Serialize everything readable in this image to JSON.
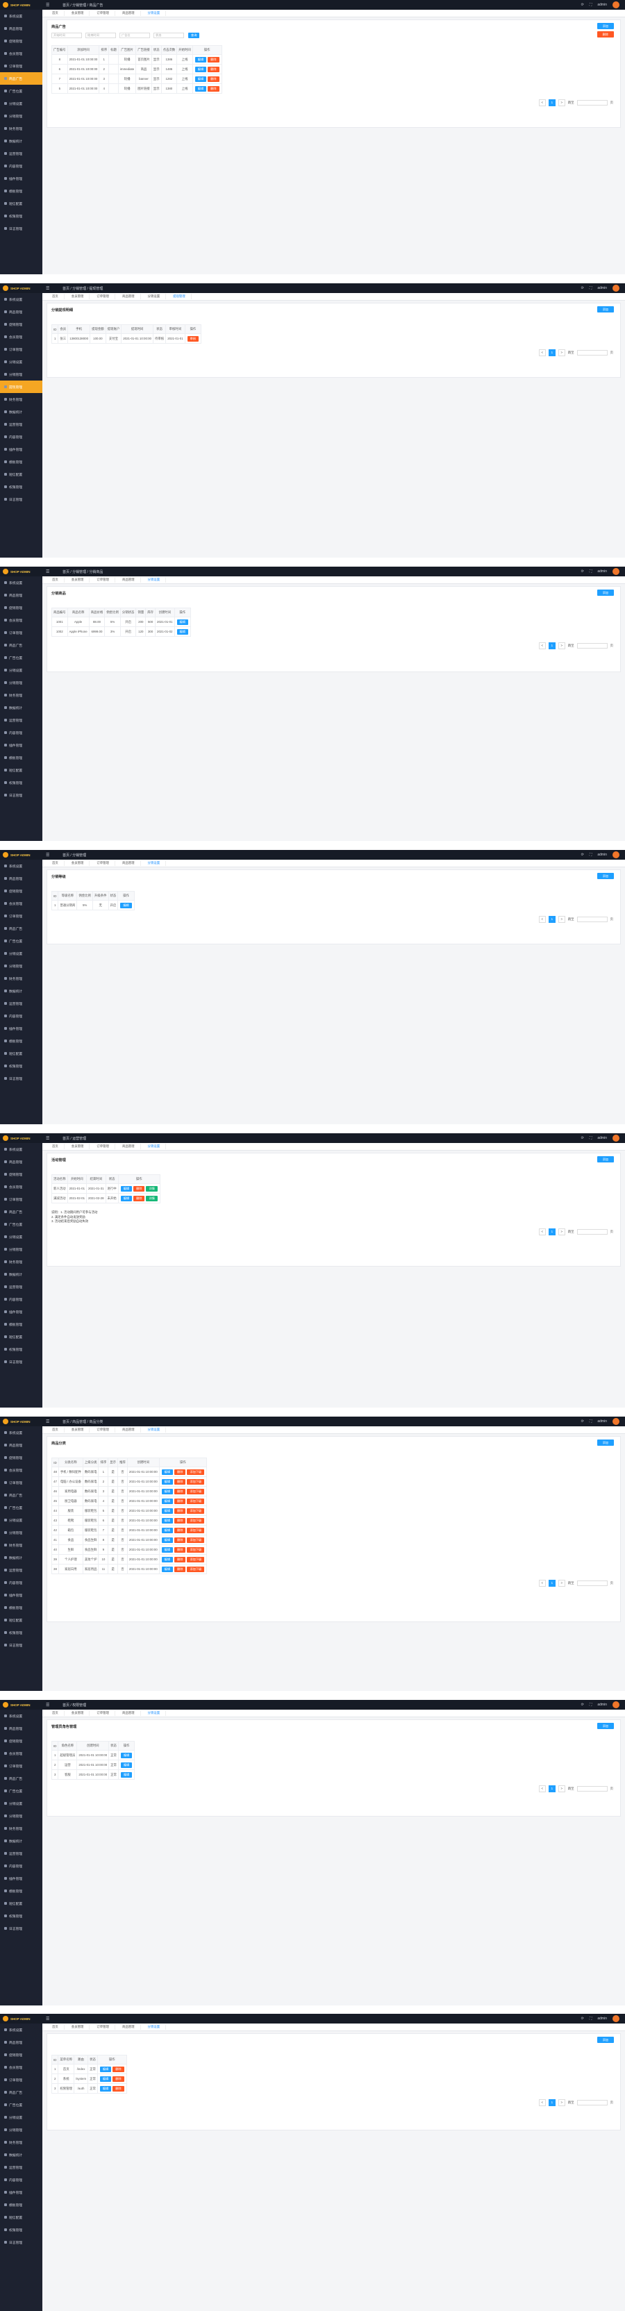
{
  "app": {
    "logo_text": "SHOP ADMIN",
    "watermark": "https://www.huzhan.com/ishop42377",
    "user": "admin"
  },
  "panels": [
    {
      "breadcrumb": "首页 / 分销管理 / 商品广告",
      "sidebar": [
        "系统设置",
        "商品管理",
        "促销管理",
        "会员管理",
        "订单管理",
        "商品广告",
        "广告位置",
        "分销设置",
        "分销管理",
        "财务管理",
        "数据统计",
        "运营管理",
        "内容管理",
        "插件管理",
        "模板管理",
        "短信配置",
        "权限管理",
        "日志管理"
      ],
      "active_sidebar": 5,
      "title": "商品广告",
      "tools": [
        "添加",
        "删除"
      ],
      "filters": [
        "开始时间",
        "结束时间",
        "广告位",
        "状态",
        "查询"
      ],
      "columns": [
        "广告编号",
        "添加时间",
        "排序",
        "标题",
        "广告图片",
        "广告链接",
        "状态",
        "点击次数",
        "开始时间",
        "操作"
      ],
      "rows": [
        [
          "8",
          "2021-01-01 10:00:00",
          "1",
          "",
          "轮播",
          "首页图片",
          "显示",
          "1386",
          "上线",
          ""
        ],
        [
          "6",
          "2021-01-01 10:00:00",
          "2",
          "",
          "immediate",
          "商品",
          "显示",
          "1486",
          "上线",
          ""
        ],
        [
          "7",
          "2021-01-01 10:00:00",
          "3",
          "",
          "轮播",
          "banner",
          "显示",
          "1282",
          "上线",
          ""
        ],
        [
          "5",
          "2021-01-01 10:00:00",
          "4",
          "",
          "轮播",
          "图片链接",
          "显示",
          "1380",
          "上线",
          ""
        ]
      ],
      "row_actions": [
        "编辑",
        "删除"
      ],
      "pager": [
        "1",
        "跳至",
        "页"
      ]
    },
    {
      "breadcrumb": "首页 / 分销管理 / 提现管理",
      "sidebar": [
        "系统设置",
        "商品管理",
        "促销管理",
        "会员管理",
        "订单管理",
        "分销设置",
        "分销管理",
        "提现管理",
        "财务管理",
        "数据统计",
        "运营管理",
        "内容管理",
        "插件管理",
        "模板管理",
        "短信配置",
        "权限管理",
        "日志管理"
      ],
      "active_sidebar": 7,
      "tabs": [
        "首页",
        "会员管理",
        "订单管理",
        "商品管理",
        "分销设置",
        "提现管理"
      ],
      "title": "分销提现明细",
      "columns": [
        "ID",
        "会员",
        "手机",
        "提现金额",
        "提现账户",
        "提现时间",
        "状态",
        "审核时间",
        "操作"
      ],
      "rows": [
        [
          "1",
          "张三",
          "13800138000",
          "100.00",
          "支付宝",
          "2021-01-01 10:00:00",
          "待审核",
          "2021-01-01",
          ""
        ]
      ],
      "row_actions": [
        "审核"
      ]
    },
    {
      "breadcrumb": "首页 / 分销管理 / 分销商品",
      "title": "分销商品",
      "columns": [
        "商品编号",
        "商品名称",
        "商品价格",
        "佣金比例",
        "分销状态",
        "销量",
        "库存",
        "创建时间",
        "操作"
      ],
      "rows": [
        [
          "1001",
          "Apple",
          "88.00",
          "5%",
          "开启",
          "200",
          "500",
          "2021-01-01",
          ""
        ],
        [
          "1002",
          "Apple iPhone",
          "6999.00",
          "3%",
          "开启",
          "120",
          "300",
          "2021-01-02",
          ""
        ]
      ],
      "row_actions": [
        "编辑"
      ]
    },
    {
      "breadcrumb": "首页 / 分销管理",
      "title": "分销等级",
      "columns": [
        "ID",
        "等级名称",
        "佣金比例",
        "升级条件",
        "状态",
        "操作"
      ],
      "rows": [
        [
          "1",
          "普通分销商",
          "5%",
          "无",
          "开启",
          ""
        ]
      ],
      "row_actions": [
        "编辑"
      ]
    },
    {
      "breadcrumb": "首页 / 运营管理",
      "title": "活动管理",
      "columns": [
        "活动名称",
        "开始时间",
        "结束时间",
        "状态",
        "操作"
      ],
      "rows": [
        [
          "新人活动",
          "2021-01-01",
          "2021-01-31",
          "进行中",
          ""
        ],
        [
          "满减活动",
          "2021-02-01",
          "2021-02-28",
          "未开始",
          ""
        ]
      ],
      "row_actions": [
        "编辑",
        "删除",
        "详情"
      ],
      "notes": "说明：1. 活动期间用户可参与活动\n2. 满足条件自动发放奖励\n3. 活动结束后奖励自动失效"
    },
    {
      "breadcrumb": "首页 / 商品管理 / 商品分类",
      "title": "商品分类",
      "columns": [
        "ID",
        "分类名称",
        "上级分类",
        "排序",
        "显示",
        "推荐",
        "创建时间",
        "操作"
      ],
      "rows": [
        [
          "48",
          "手机 / 数码配件",
          "数码家电",
          "1",
          "是",
          "否",
          "2021-01-01 10:00:00",
          ""
        ],
        [
          "47",
          "电脑 / 办公设备",
          "数码家电",
          "2",
          "是",
          "否",
          "2021-01-01 10:00:00",
          ""
        ],
        [
          "46",
          "家用电器",
          "数码家电",
          "3",
          "是",
          "否",
          "2021-01-01 10:00:00",
          ""
        ],
        [
          "45",
          "厨卫电器",
          "数码家电",
          "4",
          "是",
          "否",
          "2021-01-01 10:00:00",
          ""
        ],
        [
          "44",
          "服装",
          "服装鞋包",
          "5",
          "是",
          "否",
          "2021-01-01 10:00:00",
          ""
        ],
        [
          "43",
          "鞋靴",
          "服装鞋包",
          "6",
          "是",
          "否",
          "2021-01-01 10:00:00",
          ""
        ],
        [
          "42",
          "箱包",
          "服装鞋包",
          "7",
          "是",
          "否",
          "2021-01-01 10:00:00",
          ""
        ],
        [
          "41",
          "食品",
          "食品生鲜",
          "8",
          "是",
          "否",
          "2021-01-01 10:00:00",
          ""
        ],
        [
          "40",
          "生鲜",
          "食品生鲜",
          "9",
          "是",
          "否",
          "2021-01-01 10:00:00",
          ""
        ],
        [
          "39",
          "个人护理",
          "美妆个护",
          "10",
          "是",
          "否",
          "2021-01-01 10:00:00",
          ""
        ],
        [
          "38",
          "家居日用",
          "家居用品",
          "11",
          "是",
          "否",
          "2021-01-01 10:00:00",
          ""
        ]
      ],
      "row_actions": [
        "编辑",
        "删除",
        "添加下级"
      ]
    },
    {
      "breadcrumb": "首页 / 权限管理",
      "title": "管理员角色管理",
      "columns": [
        "ID",
        "角色名称",
        "创建时间",
        "状态",
        "操作"
      ],
      "rows": [
        [
          "1",
          "超级管理员",
          "2021-01-01 10:00:00",
          "正常",
          ""
        ],
        [
          "2",
          "运营",
          "2021-01-01 10:00:00",
          "正常",
          ""
        ],
        [
          "3",
          "客服",
          "2021-01-01 10:00:00",
          "正常",
          ""
        ]
      ],
      "row_actions": [
        "编辑"
      ]
    },
    {
      "title": "",
      "columns": [
        "ID",
        "菜单名称",
        "路由",
        "状态",
        "操作"
      ],
      "rows": [
        [
          "1",
          "首页",
          "/index",
          "正常",
          ""
        ],
        [
          "2",
          "系统",
          "/system",
          "正常",
          ""
        ],
        [
          "3",
          "权限管理",
          "/auth",
          "正常",
          ""
        ]
      ],
      "row_actions": [
        "编辑",
        "删除"
      ]
    }
  ]
}
